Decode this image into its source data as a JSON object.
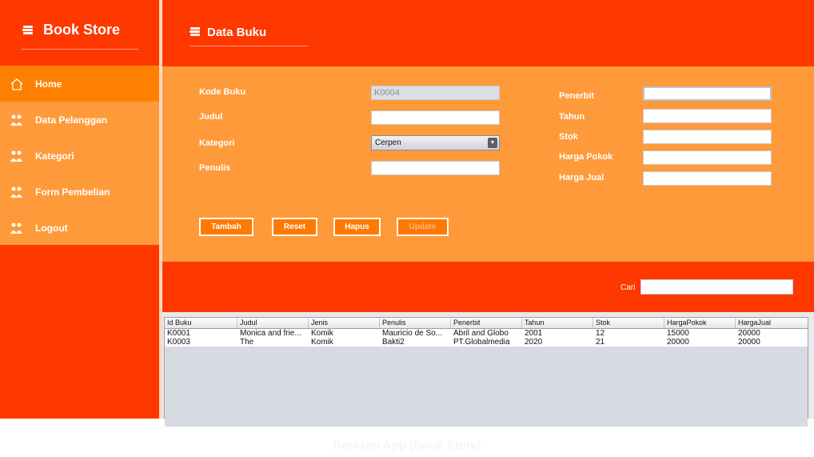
{
  "app": {
    "brand": "Book Store",
    "icon": "books-icon"
  },
  "sidebar": {
    "items": [
      {
        "label": "Home",
        "icon": "home-icon",
        "active": true
      },
      {
        "label": "Data Pelanggan",
        "icon": "users-icon"
      },
      {
        "label": "Kategori",
        "icon": "users-icon"
      },
      {
        "label": "Form Pembelian",
        "icon": "users-icon"
      },
      {
        "label": "Logout",
        "icon": "users-icon"
      }
    ]
  },
  "header": {
    "title": "Data Buku",
    "icon": "books-icon"
  },
  "form": {
    "kode_buku": {
      "label": "Kode Buku",
      "value": "K0004"
    },
    "judul": {
      "label": "Judul",
      "value": ""
    },
    "kategori": {
      "label": "Kategori",
      "value": "Cerpen"
    },
    "penulis": {
      "label": "Penulis",
      "value": ""
    },
    "penerbit": {
      "label": "Penerbit",
      "value": ""
    },
    "tahun": {
      "label": "Tahun",
      "value": ""
    },
    "stok": {
      "label": "Stok",
      "value": ""
    },
    "harga_pokok": {
      "label": "Harga Pokok",
      "value": ""
    },
    "harga_jual": {
      "label": "Harga Jual",
      "value": ""
    }
  },
  "buttons": {
    "tambah": "Tambah",
    "reset": "Reset",
    "hapus": "Hapus",
    "update": "Update"
  },
  "search": {
    "label": "Cari",
    "value": ""
  },
  "table": {
    "columns": [
      "Id Buku",
      "Judul",
      "Jenis",
      "Penulis",
      "Penerbit",
      "Tahun",
      "Stok",
      "HargaPokok",
      "HargaJual"
    ],
    "rows": [
      [
        "K0001",
        "Monica and frie...",
        "Komik",
        "Mauricio de So...",
        "Abril and Globo",
        "2001",
        "12",
        "15000",
        "20000"
      ],
      [
        "K0003",
        "The",
        "Komik",
        "Bakti2",
        "PT.Globalmedia",
        "2020",
        "21",
        "20000",
        "20000"
      ]
    ]
  },
  "caption": "Desktop App (Book Store)",
  "colors": {
    "primary": "#ff3800",
    "panel": "#ff9a3a",
    "active": "#ff8000"
  }
}
